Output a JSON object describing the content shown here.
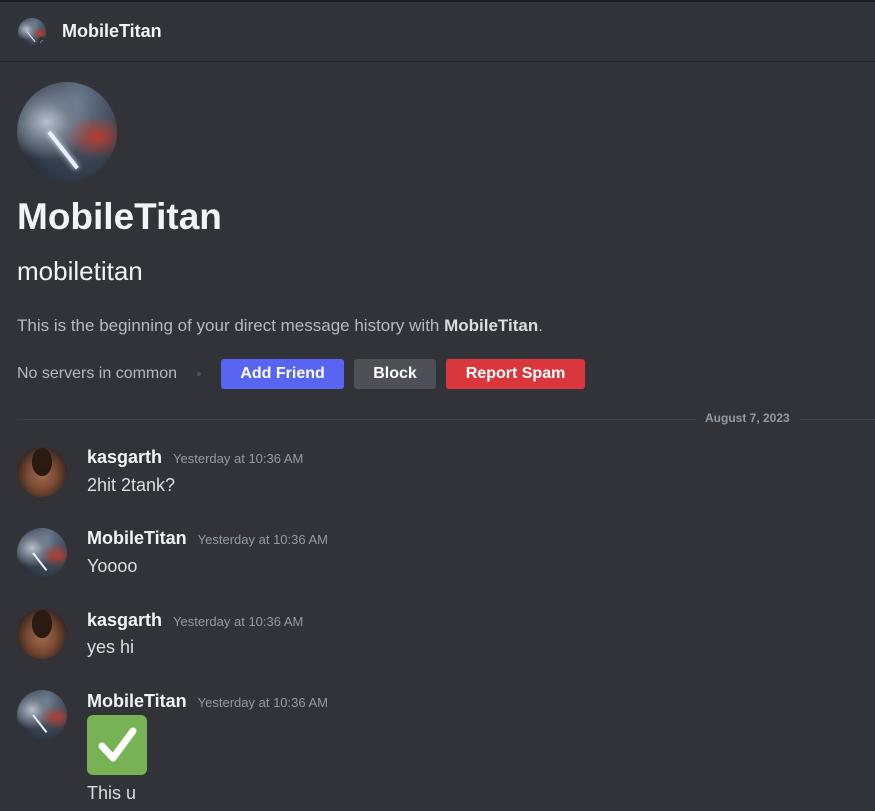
{
  "header": {
    "channel_name": "MobileTitan"
  },
  "profile": {
    "display_name": "MobileTitan",
    "username": "mobiletitan",
    "intro_prefix": "This is the beginning of your direct message history with ",
    "intro_name": "MobileTitan",
    "intro_suffix": ".",
    "mutual_servers": "No servers in common",
    "add_friend_label": "Add Friend",
    "block_label": "Block",
    "report_spam_label": "Report Spam"
  },
  "date_divider": "August 7, 2023",
  "messages": [
    {
      "author": "kasgarth",
      "timestamp": "Yesterday at 10:36 AM",
      "text": "2hit 2tank?"
    },
    {
      "author": "MobileTitan",
      "timestamp": "Yesterday at 10:36 AM",
      "text": "Yoooo"
    },
    {
      "author": "kasgarth",
      "timestamp": "Yesterday at 10:36 AM",
      "text": "yes hi"
    },
    {
      "author": "MobileTitan",
      "timestamp": "Yesterday at 10:36 AM",
      "emoji": "check-mark-button",
      "text": "This u"
    }
  ],
  "colors": {
    "background": "#313338",
    "add_friend": "#5865f2",
    "block": "#4e5058",
    "report_spam": "#da373c",
    "check_emoji": "#77b255"
  }
}
